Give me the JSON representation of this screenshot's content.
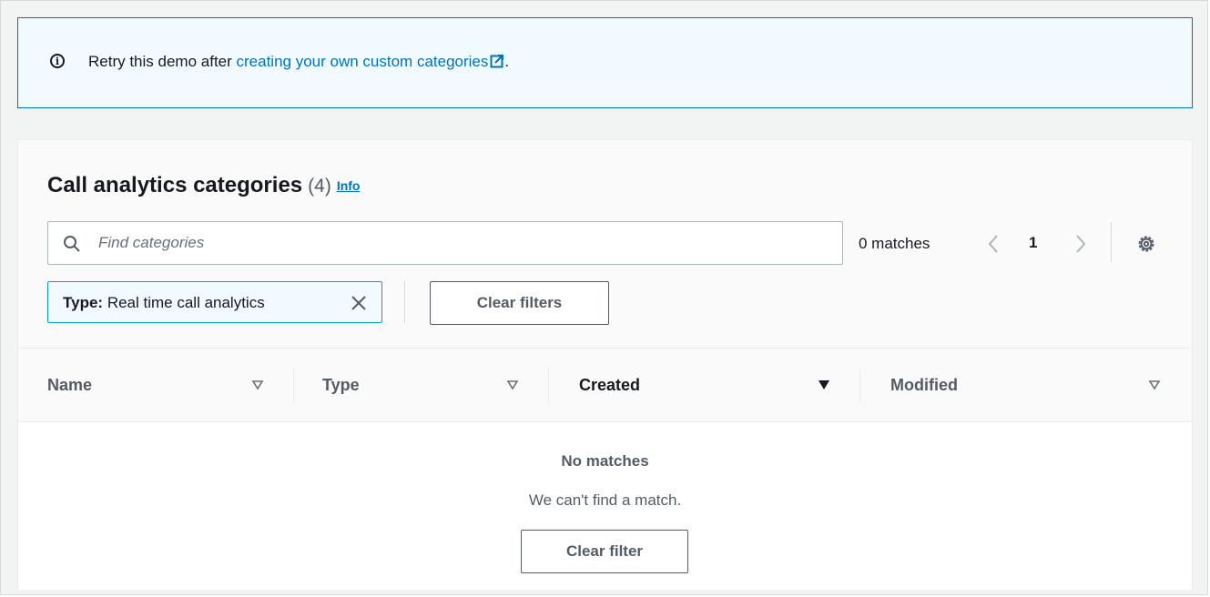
{
  "banner": {
    "text_before": "Retry this demo after ",
    "link_text": "creating your own custom categories",
    "text_after": ".",
    "icon": "info-icon",
    "link_icon": "external-link-icon"
  },
  "table": {
    "title": "Call analytics categories",
    "count": "(4)",
    "info_label": "Info",
    "search": {
      "placeholder": "Find categories",
      "value": ""
    },
    "matches_text": "0 matches",
    "pagination": {
      "current_page": "1"
    },
    "filter_token": {
      "key": "Type:",
      "value": "Real time call analytics"
    },
    "clear_filters_label": "Clear filters",
    "columns": [
      {
        "label": "Name",
        "sort": "none"
      },
      {
        "label": "Type",
        "sort": "none"
      },
      {
        "label": "Created",
        "sort": "descending"
      },
      {
        "label": "Modified",
        "sort": "none"
      }
    ],
    "empty_state": {
      "title": "No matches",
      "message": "We can't find a match.",
      "button_label": "Clear filter"
    }
  },
  "colors": {
    "accent": "#0073bb",
    "banner_bg": "#f1faff",
    "token_border": "#00a1c9"
  }
}
